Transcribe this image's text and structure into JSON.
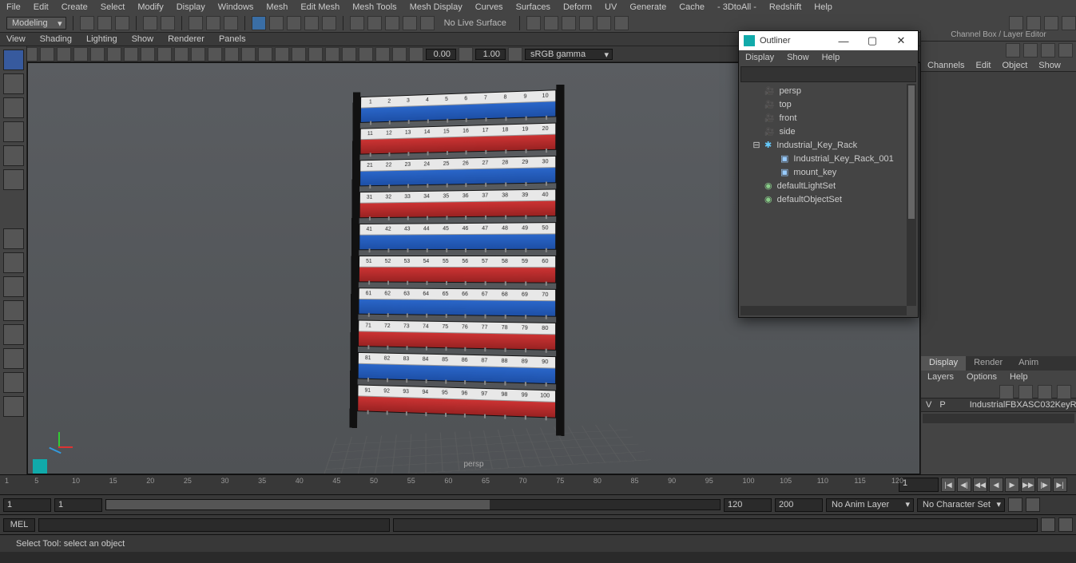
{
  "menubar": [
    "File",
    "Edit",
    "Create",
    "Select",
    "Modify",
    "Display",
    "Windows",
    "Mesh",
    "Edit Mesh",
    "Mesh Tools",
    "Mesh Display",
    "Curves",
    "Surfaces",
    "Deform",
    "UV",
    "Generate",
    "Cache",
    "- 3DtoAll -",
    "Redshift",
    "Help"
  ],
  "shelf": {
    "mode": "Modeling",
    "live_surface": "No Live Surface"
  },
  "panelbar": [
    "View",
    "Shading",
    "Lighting",
    "Show",
    "Renderer",
    "Panels"
  ],
  "vpstrip": {
    "field0": "0.00",
    "field1": "1.00",
    "colorspace": "sRGB gamma"
  },
  "viewport": {
    "camera_label": "persp"
  },
  "rack_rows": [
    {
      "color": "blue",
      "labels": [
        "1",
        "2",
        "3",
        "4",
        "5",
        "6",
        "7",
        "8",
        "9",
        "10"
      ]
    },
    {
      "color": "red",
      "labels": [
        "11",
        "12",
        "13",
        "14",
        "15",
        "16",
        "17",
        "18",
        "19",
        "20"
      ]
    },
    {
      "color": "blue",
      "labels": [
        "21",
        "22",
        "23",
        "24",
        "25",
        "26",
        "27",
        "28",
        "29",
        "30"
      ]
    },
    {
      "color": "red",
      "labels": [
        "31",
        "32",
        "33",
        "34",
        "35",
        "36",
        "37",
        "38",
        "39",
        "40"
      ]
    },
    {
      "color": "blue",
      "labels": [
        "41",
        "42",
        "43",
        "44",
        "45",
        "46",
        "47",
        "48",
        "49",
        "50"
      ]
    },
    {
      "color": "red",
      "labels": [
        "51",
        "52",
        "53",
        "54",
        "55",
        "56",
        "57",
        "58",
        "59",
        "60"
      ]
    },
    {
      "color": "blue",
      "labels": [
        "61",
        "62",
        "63",
        "64",
        "65",
        "66",
        "67",
        "68",
        "69",
        "70"
      ]
    },
    {
      "color": "red",
      "labels": [
        "71",
        "72",
        "73",
        "74",
        "75",
        "76",
        "77",
        "78",
        "79",
        "80"
      ]
    },
    {
      "color": "blue",
      "labels": [
        "81",
        "82",
        "83",
        "84",
        "85",
        "86",
        "87",
        "88",
        "89",
        "90"
      ]
    },
    {
      "color": "red",
      "labels": [
        "91",
        "92",
        "93",
        "94",
        "95",
        "96",
        "97",
        "98",
        "99",
        "100"
      ]
    }
  ],
  "outliner": {
    "title": "Outliner",
    "menus": [
      "Display",
      "Show",
      "Help"
    ],
    "items": [
      {
        "type": "cam",
        "name": "persp",
        "depth": 0
      },
      {
        "type": "cam",
        "name": "top",
        "depth": 0
      },
      {
        "type": "cam",
        "name": "front",
        "depth": 0
      },
      {
        "type": "cam",
        "name": "side",
        "depth": 0
      },
      {
        "type": "grp",
        "name": "Industrial_Key_Rack",
        "depth": 0,
        "expanded": true
      },
      {
        "type": "mesh",
        "name": "Industrial_Key_Rack_001",
        "depth": 1
      },
      {
        "type": "mesh",
        "name": "mount_key",
        "depth": 1
      },
      {
        "type": "set",
        "name": "defaultLightSet",
        "depth": 0
      },
      {
        "type": "set",
        "name": "defaultObjectSet",
        "depth": 0
      }
    ]
  },
  "rpanel": {
    "header": "Channel Box / Layer Editor",
    "tabs4": [
      "Channels",
      "Edit",
      "Object",
      "Show"
    ],
    "tabs3": [
      "Display",
      "Render",
      "Anim"
    ],
    "tabs3_active": 0,
    "lmenus": [
      "Layers",
      "Options",
      "Help"
    ],
    "layer_row": {
      "v": "V",
      "p": "P",
      "name": "IndustrialFBXASC032KeyR"
    }
  },
  "timeline": {
    "ticks": [
      1,
      5,
      10,
      15,
      20,
      25,
      30,
      35,
      40,
      45,
      50,
      55,
      60,
      65,
      70,
      75,
      80,
      85,
      90,
      95,
      100,
      105,
      110,
      115,
      120
    ],
    "current": "1"
  },
  "range": {
    "start_outer": "1",
    "start_inner": "1",
    "end_inner": "120",
    "end_outer": "200",
    "slider_label": "120",
    "anim_layer": "No Anim Layer",
    "char_set": "No Character Set"
  },
  "cmd": {
    "lang": "MEL"
  },
  "status": "Select Tool: select an object"
}
